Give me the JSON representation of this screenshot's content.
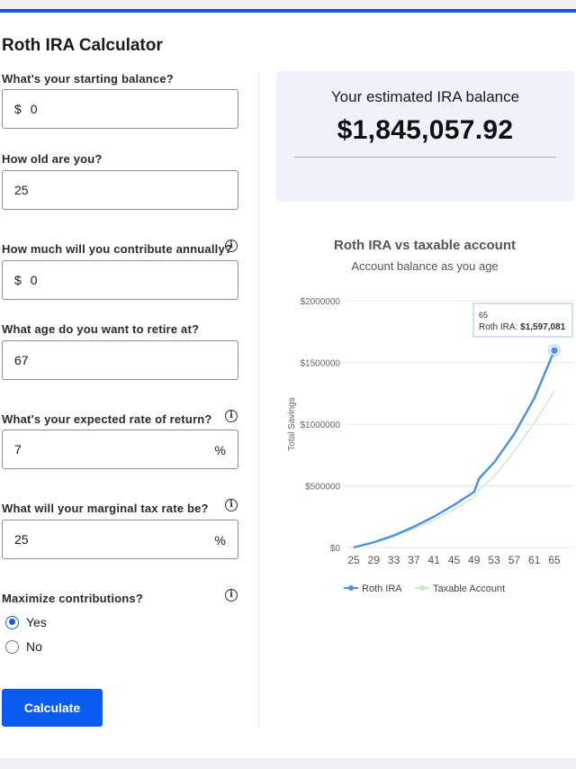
{
  "page": {
    "title": "Roth IRA Calculator"
  },
  "form": {
    "starting_balance": {
      "label": "What's your starting balance?",
      "prefix": "$",
      "value": "0"
    },
    "age": {
      "label": "How old are you?",
      "value": "25"
    },
    "annual_contribution": {
      "label": "How much will you contribute annually?",
      "prefix": "$",
      "value": "0"
    },
    "retire_age": {
      "label": "What age do you want to retire at?",
      "value": "67"
    },
    "rate_of_return": {
      "label": "What's your expected rate of return?",
      "value": "7",
      "suffix": "%"
    },
    "tax_rate": {
      "label": "What will your marginal tax rate be?",
      "value": "25",
      "suffix": "%"
    },
    "maximize": {
      "label": "Maximize contributions?",
      "options": [
        "Yes",
        "No"
      ],
      "selected": "Yes"
    },
    "calculate_label": "Calculate"
  },
  "result": {
    "label": "Your estimated IRA balance",
    "value": "$1,845,057.92"
  },
  "chart": {
    "title": "Roth IRA vs taxable account",
    "subtitle": "Account balance as you age",
    "tooltip": {
      "age": "65",
      "series": "Roth IRA:",
      "value": "$1,597,081"
    }
  },
  "colors": {
    "accent": "#0b5bf5",
    "roth": "#4a90e2",
    "taxable": "#c7ebc3",
    "card": "#eef2fb"
  },
  "chart_data": {
    "type": "line",
    "ylabel": "Total Savings",
    "ylim": [
      0,
      2000000
    ],
    "y_ticks": [
      0,
      500000,
      1000000,
      1500000,
      2000000
    ],
    "y_tick_labels": [
      "$0",
      "$500000",
      "$1000000",
      "$1500000",
      "$2000000"
    ],
    "x_tick_labels": [
      "25",
      "29",
      "33",
      "37",
      "41",
      "45",
      "49",
      "53",
      "57",
      "61",
      "65"
    ],
    "x": [
      25,
      29,
      33,
      37,
      41,
      45,
      49,
      50,
      53,
      57,
      61,
      65
    ],
    "series": [
      {
        "name": "Roth IRA",
        "values": [
          0,
          42000,
          98000,
          168000,
          250000,
          345000,
          450000,
          560000,
          690000,
          920000,
          1210000,
          1597081
        ]
      },
      {
        "name": "Taxable Account",
        "values": [
          0,
          38000,
          88000,
          150000,
          225000,
          310000,
          405000,
          470000,
          575000,
          780000,
          1010000,
          1270000
        ]
      }
    ],
    "legend": "bottom",
    "grid": true
  }
}
